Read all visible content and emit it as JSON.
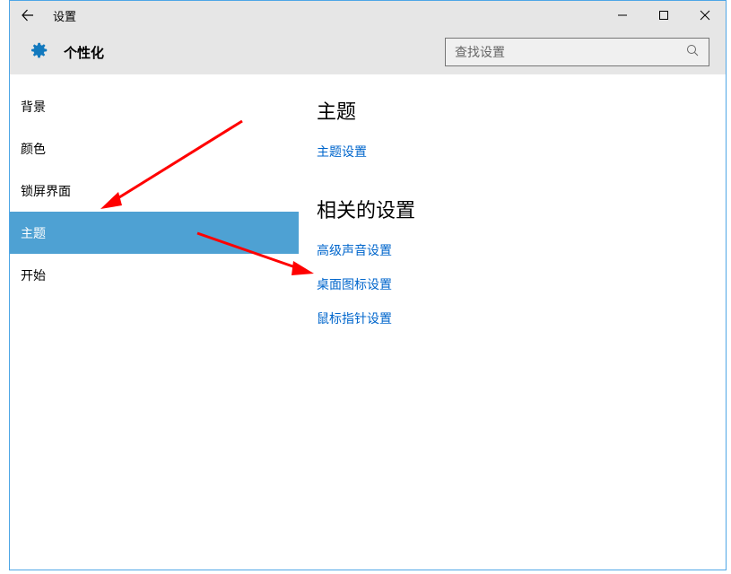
{
  "window": {
    "title": "设置"
  },
  "header": {
    "title": "个性化"
  },
  "search": {
    "placeholder": "查找设置"
  },
  "sidebar": {
    "items": [
      {
        "label": "背景",
        "selected": false
      },
      {
        "label": "颜色",
        "selected": false
      },
      {
        "label": "锁屏界面",
        "selected": false
      },
      {
        "label": "主题",
        "selected": true
      },
      {
        "label": "开始",
        "selected": false
      }
    ]
  },
  "main": {
    "section1": {
      "title": "主题",
      "links": [
        {
          "label": "主题设置"
        }
      ]
    },
    "section2": {
      "title": "相关的设置",
      "links": [
        {
          "label": "高级声音设置"
        },
        {
          "label": "桌面图标设置"
        },
        {
          "label": "鼠标指针设置"
        }
      ]
    }
  }
}
